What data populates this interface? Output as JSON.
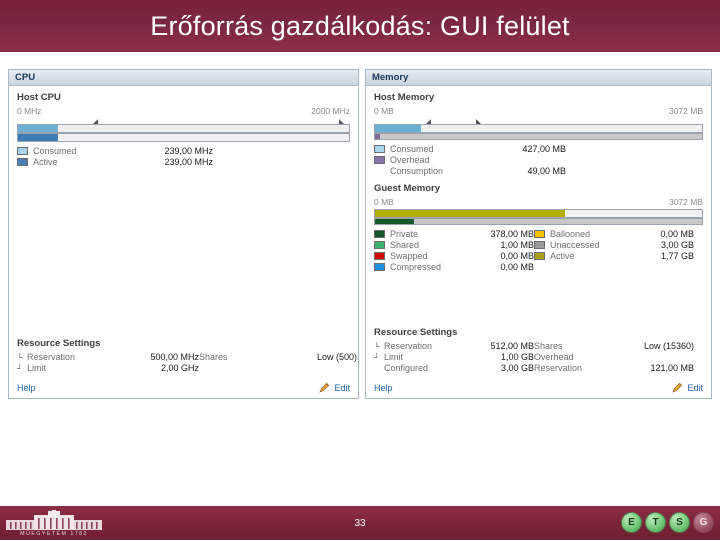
{
  "slide": {
    "title": "Erőforrás gazdálkodás: GUI felület",
    "page_number": "33",
    "accent_color": "#7a2238"
  },
  "cpu_panel": {
    "header": "CPU",
    "section_title": "Host CPU",
    "scale_min": "0 MHz",
    "scale_max": "2000 MHz",
    "bars": [
      {
        "name": "Consumed",
        "percent": 12,
        "color": "#6baed6"
      },
      {
        "name": "Active",
        "percent": 12,
        "color": "#3b7ab3"
      }
    ],
    "legend": [
      {
        "label": "Consumed",
        "value": "239,00 MHz",
        "color": "#a9d4ef"
      },
      {
        "label": "Active",
        "value": "239,00 MHz",
        "color": "#4a7fb5"
      }
    ],
    "resource_settings": {
      "title": "Resource Settings",
      "rows": [
        {
          "name": "Reservation",
          "value": "500,00 MHz"
        },
        {
          "name": "Limit",
          "value": "2,00 GHz"
        }
      ],
      "right_rows": [
        {
          "name": "Shares",
          "value": "Low (500)"
        }
      ]
    },
    "help_label": "Help",
    "edit_label": "Edit"
  },
  "memory_panel": {
    "header": "Memory",
    "host": {
      "section_title": "Host Memory",
      "scale_min": "0 MB",
      "scale_max": "3072 MB",
      "bars": [
        {
          "name": "Consumed",
          "percent": 14,
          "color": "#6baed6"
        },
        {
          "name": "Overhead",
          "percent": 1.6,
          "color": "#7d6b9e"
        }
      ],
      "legend": [
        {
          "label": "Consumed",
          "value": "427,00 MB",
          "color": "#a9d4ef"
        },
        {
          "label": "Overhead",
          "value": "",
          "color": "#8a76ad"
        },
        {
          "label": "Consumption",
          "value": "49,00 MB",
          "color": ""
        }
      ]
    },
    "guest": {
      "section_title": "Guest Memory",
      "scale_min": "0 MB",
      "scale_max": "3072 MB",
      "bars": [
        {
          "name": "Active",
          "percent": 58,
          "color": "#b3ad00"
        },
        {
          "name": "Private",
          "percent": 12,
          "color": "#17592c"
        }
      ],
      "legend_left": [
        {
          "label": "Private",
          "value": "378,00 MB",
          "color": "#14532a"
        },
        {
          "label": "Shared",
          "value": "1,00 MB",
          "color": "#3bb273"
        },
        {
          "label": "Swapped",
          "value": "0,00 MB",
          "color": "#d00000"
        },
        {
          "label": "Compressed",
          "value": "0,00 MB",
          "color": "#1f8fe0"
        }
      ],
      "legend_right": [
        {
          "label": "Ballooned",
          "value": "0,00 MB",
          "color": "#f2c200"
        },
        {
          "label": "Unaccessed",
          "value": "3,00 GB",
          "color": "#9a9a9a"
        },
        {
          "label": "Active",
          "value": "1,77 GB",
          "color": "#a8a017"
        }
      ]
    },
    "resource_settings": {
      "title": "Resource Settings",
      "rows": [
        {
          "name": "Reservation",
          "value": "512,00 MB"
        },
        {
          "name": "Limit",
          "value": "1,00 GB"
        },
        {
          "name": "Configured",
          "value": "3,00 GB"
        }
      ],
      "right_rows": [
        {
          "name": "Shares",
          "value": "Low (15360)"
        },
        {
          "name": "Overhead",
          "value": ""
        },
        {
          "name": "Reservation",
          "value": "121,00 MB"
        }
      ]
    },
    "help_label": "Help",
    "edit_label": "Edit"
  },
  "footer": {
    "logo_caption": "MŰEGYETEM 1782",
    "badges": [
      {
        "letter": "E",
        "style": "g"
      },
      {
        "letter": "T",
        "style": "g"
      },
      {
        "letter": "S",
        "style": "g"
      },
      {
        "letter": "G",
        "style": "d"
      }
    ]
  }
}
